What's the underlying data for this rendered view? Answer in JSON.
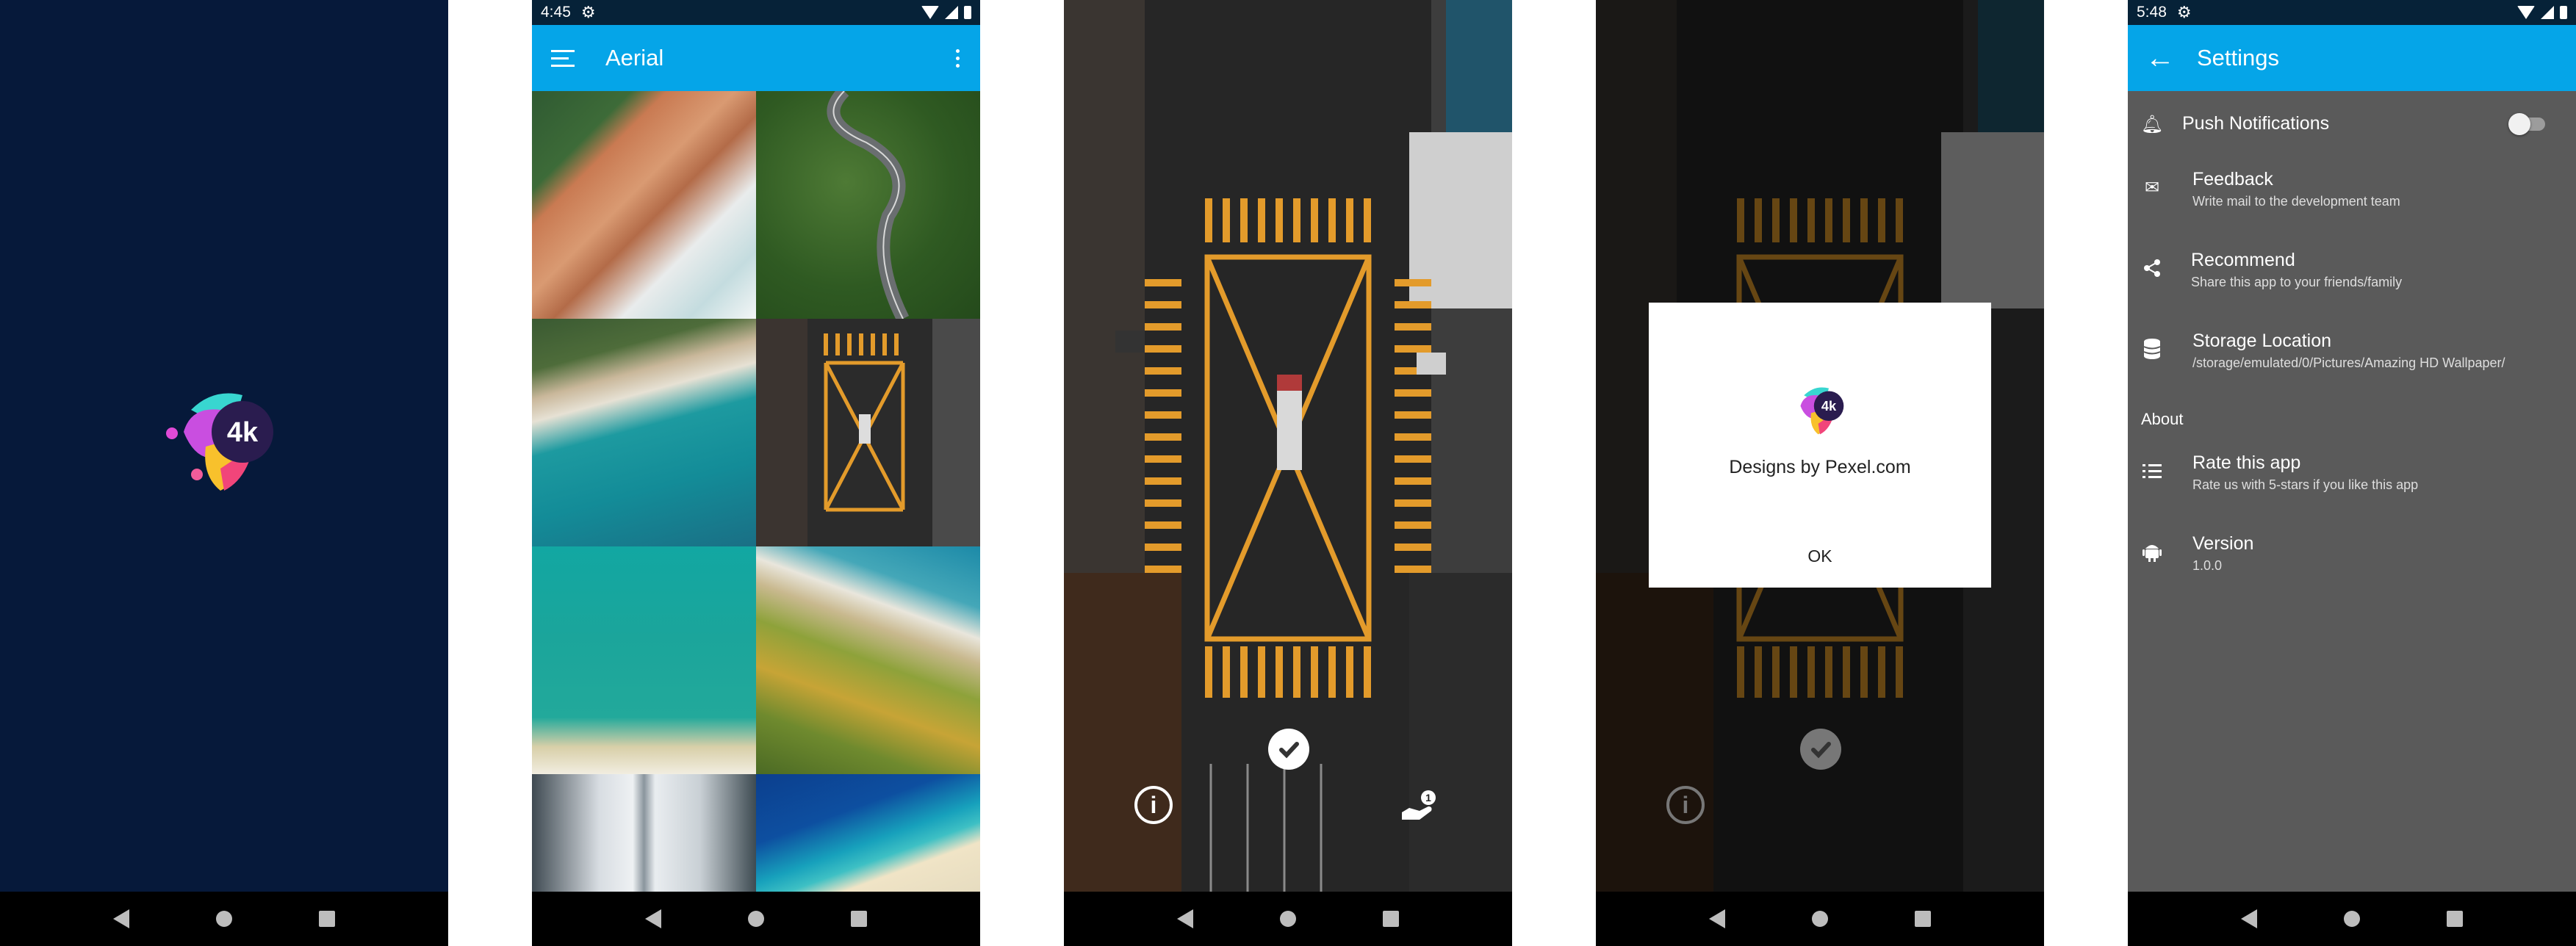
{
  "splash": {
    "logo_text": "4k",
    "background": "#06193a"
  },
  "aerial": {
    "status": {
      "time": "4:45"
    },
    "toolbar": {
      "title": "Aerial",
      "accent": "#05a5e8"
    },
    "grid_tiles": [
      {
        "name": "rocky-coast"
      },
      {
        "name": "forest-road"
      },
      {
        "name": "turquoise-shore"
      },
      {
        "name": "city-intersection"
      },
      {
        "name": "lagoon-water"
      },
      {
        "name": "palm-beach"
      },
      {
        "name": "snowy-road"
      },
      {
        "name": "tropical-beach"
      }
    ]
  },
  "viewer": {
    "icons": [
      "check-circle-icon",
      "info-icon",
      "hand-badge-icon"
    ],
    "badge": "1"
  },
  "about_dialog": {
    "logo_text": "4k",
    "credit": "Designs by Pexel.com",
    "ok_label": "OK"
  },
  "settings": {
    "status": {
      "time": "5:48"
    },
    "toolbar": {
      "title": "Settings"
    },
    "push": {
      "label": "Push Notifications",
      "enabled": false
    },
    "feedback": {
      "title": "Feedback",
      "subtitle": "Write mail to the development team"
    },
    "recommend": {
      "title": "Recommend",
      "subtitle": "Share this app to your friends/family"
    },
    "storage": {
      "title": "Storage Location",
      "subtitle": "/storage/emulated/0/Pictures/Amazing HD Wallpaper/"
    },
    "about_header": "About",
    "rate": {
      "title": "Rate this app",
      "subtitle": "Rate us with 5-stars if you like this app"
    },
    "version": {
      "title": "Version",
      "subtitle": "1.0.0"
    }
  }
}
